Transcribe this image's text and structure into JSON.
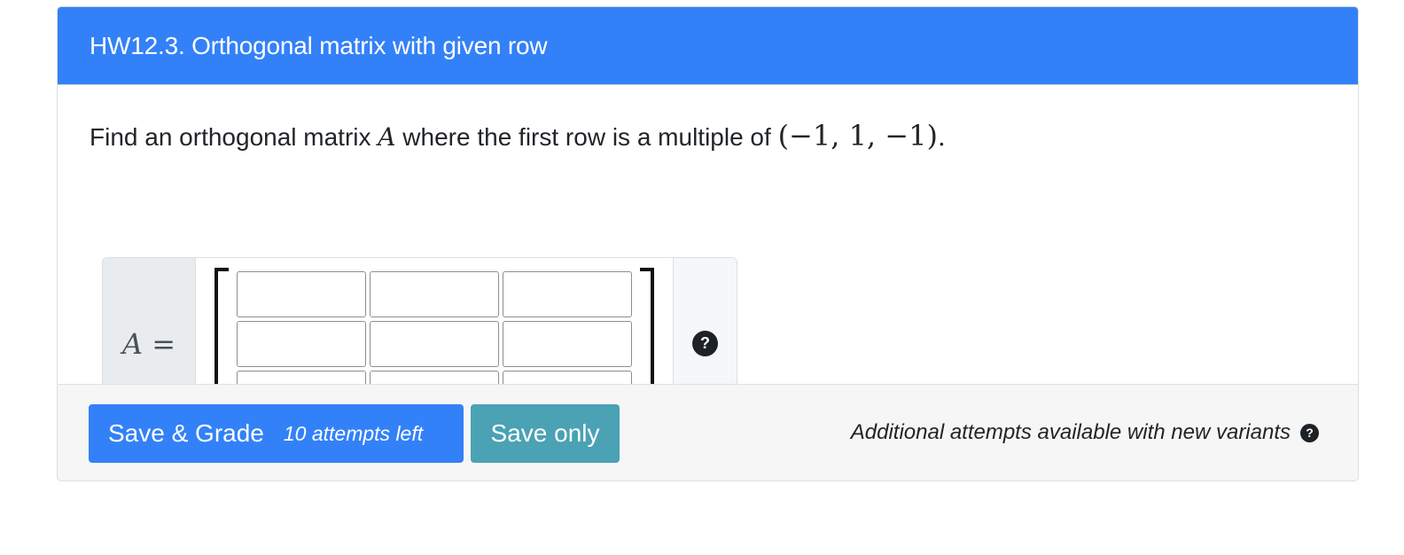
{
  "question": {
    "title": "HW12.3. Orthogonal matrix with given row",
    "prompt_before": "Find an orthogonal matrix ",
    "prompt_var": "A",
    "prompt_middle": " where the first row is a multiple of ",
    "prompt_vector": "(−1, 1, −1)",
    "prompt_after": "."
  },
  "answer": {
    "lhs_label": "A =",
    "help_icon": "question-circle-icon",
    "help_glyph": "?",
    "cells": [
      [
        "",
        "",
        ""
      ],
      [
        "",
        "",
        ""
      ],
      [
        "",
        "",
        ""
      ]
    ]
  },
  "footer": {
    "grade_label": "Save & Grade",
    "attempts_label": "10 attempts left",
    "save_label": "Save only",
    "note": "Additional attempts available with new variants",
    "note_glyph": "?"
  },
  "colors": {
    "header_blue": "#3381f8",
    "save_teal": "#4aa2b4"
  }
}
